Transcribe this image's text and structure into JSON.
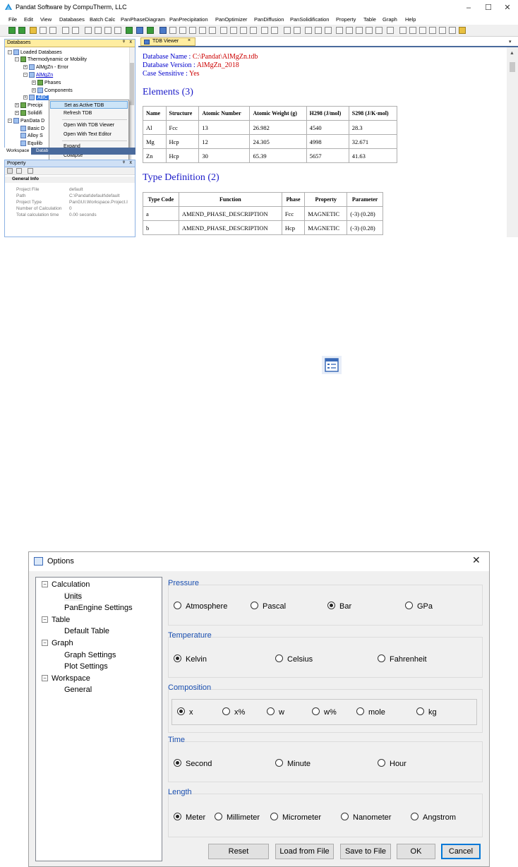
{
  "app": {
    "title": "Pandat Software by CompuTherm, LLC",
    "menu": [
      "File",
      "Edit",
      "View",
      "Databases",
      "Batch Calc",
      "PanPhaseDiagram",
      "PanPrecipitation",
      "PanOptimizer",
      "PanDiffusion",
      "PanSolidification",
      "Property",
      "Table",
      "Graph",
      "Help"
    ],
    "window_controls": {
      "minimize": "–",
      "maximize": "☐",
      "close": "✕"
    }
  },
  "databases_pane": {
    "title": "Databases",
    "pin": "ᵠ",
    "close": "x",
    "tree": {
      "loaded": "Loaded Databases",
      "thermo": "Thermodynamic or Mobility",
      "almgzn_error": "AlMgZn - Error",
      "almgzn": "AlMgZn",
      "phases": "Phases",
      "components": "Components",
      "abc": "ABC",
      "precip": "Precipi",
      "solidif": "Solidifi",
      "pandata": "PanData D",
      "basic": "Basic D",
      "alloy": "Alloy S",
      "equilib": "Equilib"
    }
  },
  "context_menu": {
    "items": [
      "Set as Active TDB",
      "Refresh TDB",
      "Open With TDB Viewer",
      "Open With Text Editor",
      "Expand",
      "Collapse"
    ]
  },
  "bottom_tabs": [
    "Workspace",
    "Datab"
  ],
  "property_pane": {
    "title": "Property",
    "category": "General Info",
    "rows": [
      {
        "k": "Project File",
        "v": "default"
      },
      {
        "k": "Path",
        "v": "C:\\Pandat\\default\\default"
      },
      {
        "k": "Project Type",
        "v": "PanGUI.Workspace.Project.I"
      },
      {
        "k": "Number of Calculation",
        "v": "0"
      },
      {
        "k": "Total calculation time",
        "v": "0.00 seconds"
      }
    ]
  },
  "tdb_viewer": {
    "tab": "TDB Viewer",
    "tab_close": "×",
    "db_name_label": "Database Name : ",
    "db_name": "C:\\Pandat\\AlMgZn.tdb",
    "db_version_label": "Database Version : ",
    "db_version": "AlMgZn_2018",
    "case_label": "Case Sensitive : ",
    "case": "Yes",
    "elements_heading": "Elements (3)",
    "elements_headers": [
      "Name",
      "Structure",
      "Atomic Number",
      "Atomic Weight (g)",
      "H298 (J/mol)",
      "S298 (J/K·mol)"
    ],
    "elements_rows": [
      [
        "Al",
        "Fcc",
        "13",
        "26.982",
        "4540",
        "28.3"
      ],
      [
        "Mg",
        "Hcp",
        "12",
        "24.305",
        "4998",
        "32.671"
      ],
      [
        "Zn",
        "Hcp",
        "30",
        "65.39",
        "5657",
        "41.63"
      ]
    ],
    "type_heading": "Type Definition (2)",
    "type_headers": [
      "Type Code",
      "Function",
      "Phase",
      "Property",
      "Parameter"
    ],
    "type_rows": [
      [
        "a",
        "AMEND_PHASE_DESCRIPTION",
        "Fcc",
        "MAGNETIC",
        "(-3) (0.28)"
      ],
      [
        "b",
        "AMEND_PHASE_DESCRIPTION",
        "Hcp",
        "MAGNETIC",
        "(-3) (0.28)"
      ]
    ]
  },
  "options_dialog": {
    "title": "Options",
    "close": "✕",
    "tree": [
      {
        "label": "Calculation",
        "toggle": "⊟",
        "children": [
          "Units",
          "PanEngine Settings"
        ]
      },
      {
        "label": "Table",
        "toggle": "⊟",
        "children": [
          "Default Table"
        ]
      },
      {
        "label": "Graph",
        "toggle": "⊟",
        "children": [
          "Graph Settings",
          "Plot Settings"
        ]
      },
      {
        "label": "Workspace",
        "toggle": "⊟",
        "children": [
          "General"
        ]
      }
    ],
    "pressure": {
      "label": "Pressure",
      "options": [
        "Atmosphere",
        "Pascal",
        "Bar",
        "GPa"
      ],
      "selected": "Bar"
    },
    "temperature": {
      "label": "Temperature",
      "options": [
        "Kelvin",
        "Celsius",
        "Fahrenheit"
      ],
      "selected": "Kelvin"
    },
    "composition": {
      "label": "Composition",
      "options": [
        "x",
        "x%",
        "w",
        "w%",
        "mole",
        "kg"
      ],
      "selected": "x"
    },
    "time": {
      "label": "Time",
      "options": [
        "Second",
        "Minute",
        "Hour"
      ],
      "selected": "Second"
    },
    "length": {
      "label": "Length",
      "options": [
        "Meter",
        "Millimeter",
        "Micrometer",
        "Nanometer",
        "Angstrom"
      ],
      "selected": "Meter"
    },
    "buttons": {
      "reset": "Reset",
      "load": "Load from File",
      "save": "Save to File",
      "ok": "OK",
      "cancel": "Cancel"
    }
  }
}
